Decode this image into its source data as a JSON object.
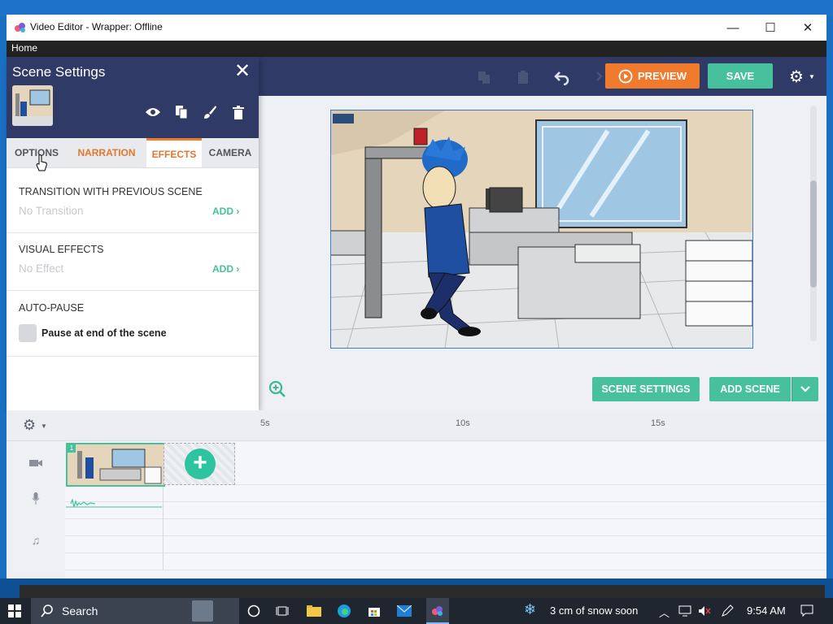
{
  "window": {
    "title": "Video Editor - Wrapper: Offline"
  },
  "menu": {
    "home": "Home"
  },
  "toolbar": {
    "preview": "PREVIEW",
    "save": "SAVE"
  },
  "panel": {
    "title": "Scene Settings",
    "tabs": [
      "OPTIONS",
      "NARRATION",
      "EFFECTS",
      "CAMERA"
    ],
    "active_tab": "EFFECTS",
    "transition": {
      "title": "TRANSITION WITH PREVIOUS SCENE",
      "value": "No Transition",
      "add": "ADD"
    },
    "visual_effects": {
      "title": "VISUAL EFFECTS",
      "value": "No Effect",
      "add": "ADD"
    },
    "autopause": {
      "title": "AUTO-PAUSE",
      "checkbox_label": "Pause at end of the scene"
    }
  },
  "stage": {
    "scene_settings": "SCENE SETTINGS",
    "add_scene": "ADD SCENE"
  },
  "timeline": {
    "ruler": [
      "5s",
      "10s",
      "15s"
    ],
    "clip_number": "1"
  },
  "taskbar": {
    "search": "Search",
    "weather": "3 cm of snow soon",
    "time": "9:54 AM"
  },
  "colors": {
    "accent_orange": "#f07b2c",
    "accent_green": "#46c19c",
    "header_navy": "#2f3a66"
  }
}
